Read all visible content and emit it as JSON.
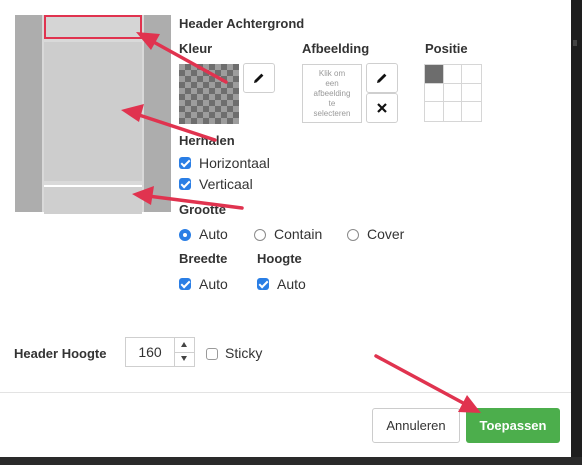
{
  "colors": {
    "accent": "#2a7ee5",
    "apply_green": "#4cae4c",
    "annotation_red": "#e0334f"
  },
  "section": {
    "title": "Header Achtergrond",
    "kleur": "Kleur",
    "afbeelding": "Afbeelding",
    "positie": "Positie",
    "image_placeholder": "Klik om een afbeelding te selecteren",
    "pencil_icon": "pencil-icon",
    "remove_icon": "close-icon",
    "position_active": "top-left"
  },
  "herhalen": {
    "title": "Herhalen",
    "options": [
      {
        "label": "Horizontaal",
        "checked": true
      },
      {
        "label": "Verticaal",
        "checked": true
      }
    ]
  },
  "grootte": {
    "title": "Grootte",
    "options": [
      {
        "label": "Auto",
        "selected": true
      },
      {
        "label": "Contain",
        "selected": false
      },
      {
        "label": "Cover",
        "selected": false
      }
    ]
  },
  "breedte": {
    "title": "Breedte",
    "label": "Auto",
    "checked": true
  },
  "hoogte": {
    "title": "Hoogte",
    "label": "Auto",
    "checked": true
  },
  "header_hoogte": {
    "label": "Header Hoogte",
    "value": "160",
    "sticky_label": "Sticky",
    "sticky_checked": false
  },
  "footer": {
    "cancel_label": "Annuleren",
    "apply_label": "Toepassen"
  }
}
